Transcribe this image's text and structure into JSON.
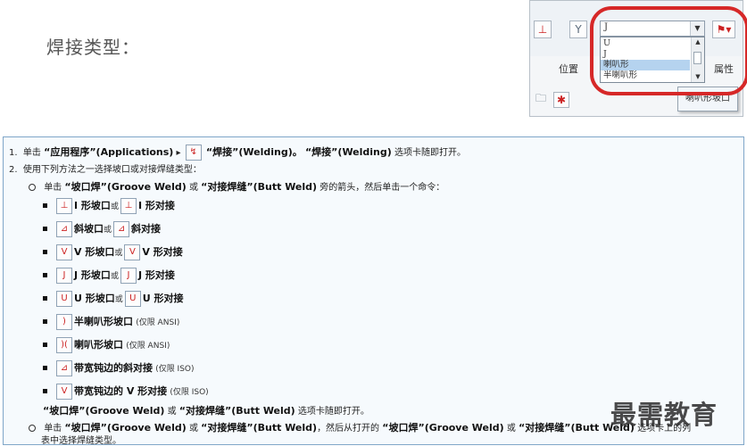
{
  "heading": "焊接类型：",
  "inset": {
    "combo_value": "J",
    "dropdown_items": [
      "U",
      "J",
      "喇叭形",
      "半喇叭形"
    ],
    "group_left": "位置",
    "group_right": "属性",
    "tooltip": "喇叭形坡口"
  },
  "steps": {
    "s1": {
      "num": "1.",
      "pre": "单击",
      "app": "“应用程序”(Applications)",
      "arrow": "▸",
      "weld": "“焊接”(Welding)。",
      "weld2": "“焊接”(Welding)",
      "post": "选项卡随即打开。"
    },
    "s2": {
      "num": "2.",
      "text": "使用下列方法之一选择坡口或对接焊缝类型："
    },
    "sub1": {
      "pre": "单击",
      "groove": "“坡口焊”(Groove Weld)",
      "or": "或",
      "butt": "“对接焊缝”(Butt Weld)",
      "post": "旁的箭头，然后单击一个命令："
    },
    "items": [
      {
        "a": "I 形坡口",
        "or": "或",
        "b": "I 形对接"
      },
      {
        "a": "斜坡口",
        "or": "或",
        "b": "斜对接"
      },
      {
        "a": "V 形坡口",
        "or": "或",
        "b": "V 形对接"
      },
      {
        "a": "J 形坡口",
        "or": "或",
        "b": "J 形对接"
      },
      {
        "a": "U 形坡口",
        "or": "或",
        "b": "U 形对接"
      },
      {
        "a": "半喇叭形坡口",
        "note": "(仅限 ANSI)"
      },
      {
        "a": "喇叭形坡口",
        "note": "(仅限 ANSI)"
      },
      {
        "a": "带宽钝边的斜对接",
        "note": "(仅限 ISO)"
      },
      {
        "a": "带宽钝边的 V 形对接",
        "note": "(仅限 ISO)"
      }
    ],
    "after": {
      "groove": "“坡口焊”(Groove Weld)",
      "or": "或",
      "butt": "“对接焊缝”(Butt Weld)",
      "post": "选项卡随即打开。"
    },
    "sub2": {
      "pre": "单击",
      "groove": "“坡口焊”(Groove Weld)",
      "or": "或",
      "butt": "“对接焊缝”(Butt Weld)",
      "mid": "，然后从打开的",
      "groove2": "“坡口焊”(Groove Weld)",
      "or2": "或",
      "butt2": "“对接焊缝”(Butt Weld)",
      "post": "选项卡上的列",
      "post2": "表中选择焊缝类型。"
    }
  },
  "watermark": "最需教育",
  "colors": {
    "accent_red": "#d62828",
    "box_border": "#7fa6c8",
    "selection": "#b5d3ef"
  }
}
